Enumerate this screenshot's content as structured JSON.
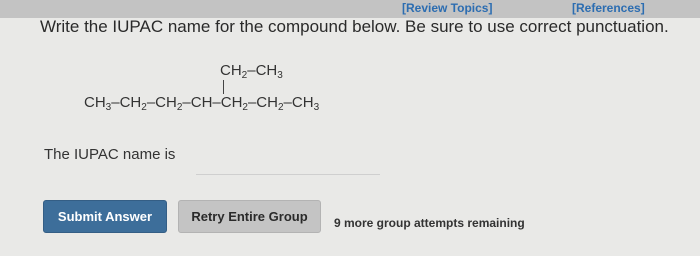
{
  "header": {
    "review_link": "[Review Topics]",
    "references_link": "[References]"
  },
  "question": {
    "prompt": "Write the IUPAC name for the compound below. Be sure to use correct punctuation."
  },
  "structure": {
    "branch_group": [
      "CH",
      "2",
      "–CH",
      "3"
    ],
    "main_chain": [
      "CH",
      "3",
      "–CH",
      "2",
      "–CH",
      "2",
      "–CH–CH",
      "2",
      "–CH",
      "2",
      "–CH",
      "3"
    ]
  },
  "answer": {
    "label": "The IUPAC name is",
    "value": "",
    "placeholder": ""
  },
  "buttons": {
    "submit": "Submit Answer",
    "retry": "Retry Entire Group"
  },
  "status": {
    "attempts_remaining": "9 more group attempts remaining"
  },
  "colors": {
    "link": "#2c6db1",
    "submit_bg": "#3d6e9a",
    "retry_bg": "#c4c4c4",
    "page_bg": "#e9e9e7"
  }
}
